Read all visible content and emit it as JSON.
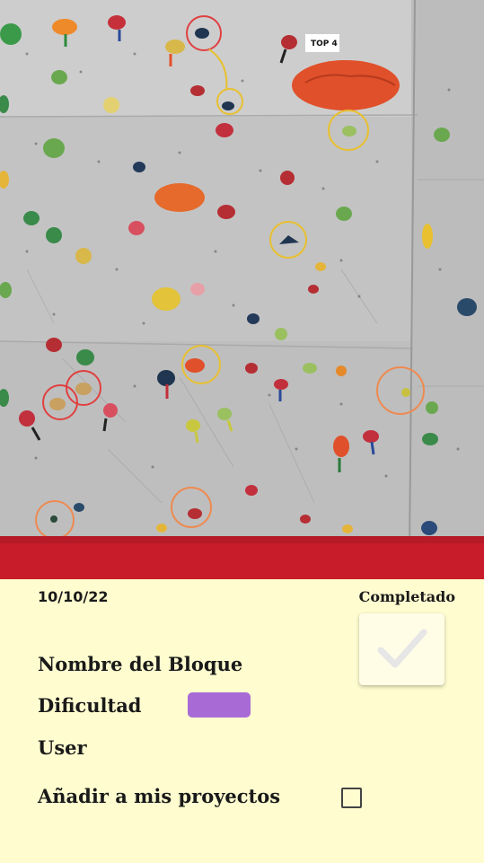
{
  "photo": {
    "alt_marker": "TOP 4",
    "route_holds": [
      "red",
      "red",
      "red",
      "yellow",
      "yellow",
      "yellow",
      "yellow",
      "orange",
      "orange",
      "orange"
    ]
  },
  "entry": {
    "date": "10/10/22",
    "status_label": "Completado",
    "completed": true,
    "name_label": "Nombre del Bloque",
    "difficulty_label": "Dificultad",
    "difficulty_color": "#a86bd6",
    "user_label": "User",
    "projects_label": "Añadir a mis proyectos",
    "in_projects": false
  },
  "colors": {
    "background": "#fffdd0",
    "check": "#e6e6e6"
  }
}
